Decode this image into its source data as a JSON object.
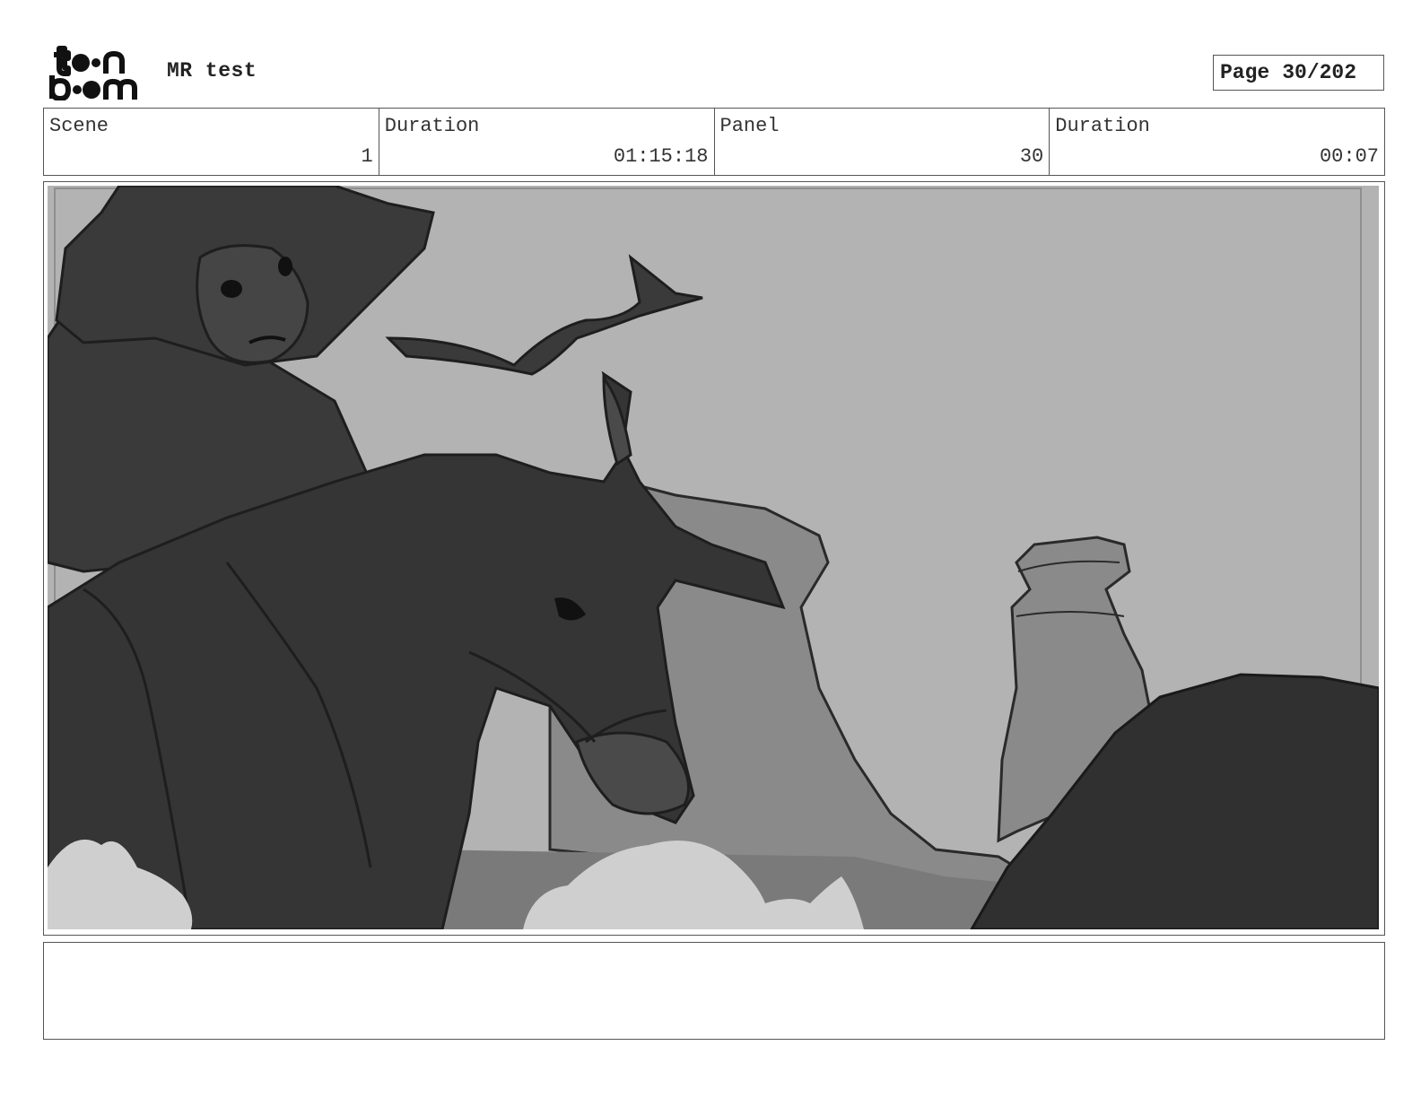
{
  "header": {
    "logo_text": "toon boom",
    "project_title": "MR test",
    "page_label": "Page",
    "page_value": "30/202"
  },
  "info": {
    "scene_label": "Scene",
    "scene_value": "1",
    "scene_duration_label": "Duration",
    "scene_duration_value": "01:15:18",
    "panel_label": "Panel",
    "panel_value": "30",
    "panel_duration_label": "Duration",
    "panel_duration_value": "00:07"
  },
  "panel": {
    "image_description": "storyboard sketch: rider in wide-brimmed hat on horseback in front of desert rock formations",
    "colors": {
      "sky": "#b3b3b3",
      "rocks": "#8a8a8a",
      "figures": "#3a3a3a",
      "dust": "#cfcfcf",
      "line": "#1e1e1e"
    }
  },
  "notes": {
    "action": ""
  }
}
